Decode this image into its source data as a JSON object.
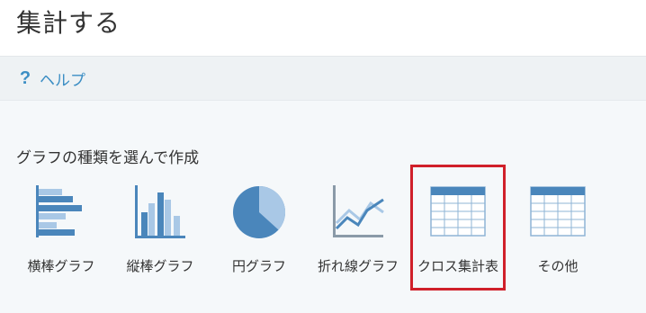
{
  "header": {
    "title": "集計する"
  },
  "help": {
    "label": "ヘルプ",
    "icon": "question-icon"
  },
  "section": {
    "label": "グラフの種類を選んで作成"
  },
  "chart_types": [
    {
      "label": "横棒グラフ",
      "icon": "horizontal-bar-chart-icon"
    },
    {
      "label": "縦棒グラフ",
      "icon": "vertical-bar-chart-icon"
    },
    {
      "label": "円グラフ",
      "icon": "pie-chart-icon"
    },
    {
      "label": "折れ線グラフ",
      "icon": "line-chart-icon"
    },
    {
      "label": "クロス集計表",
      "icon": "crosstab-table-icon",
      "highlighted": true
    },
    {
      "label": "その他",
      "icon": "other-table-icon"
    }
  ],
  "colors": {
    "accent": "#3b8ec4",
    "icon_dark": "#4a86bb",
    "icon_light": "#a9c8e6",
    "highlight": "#d0202a"
  }
}
